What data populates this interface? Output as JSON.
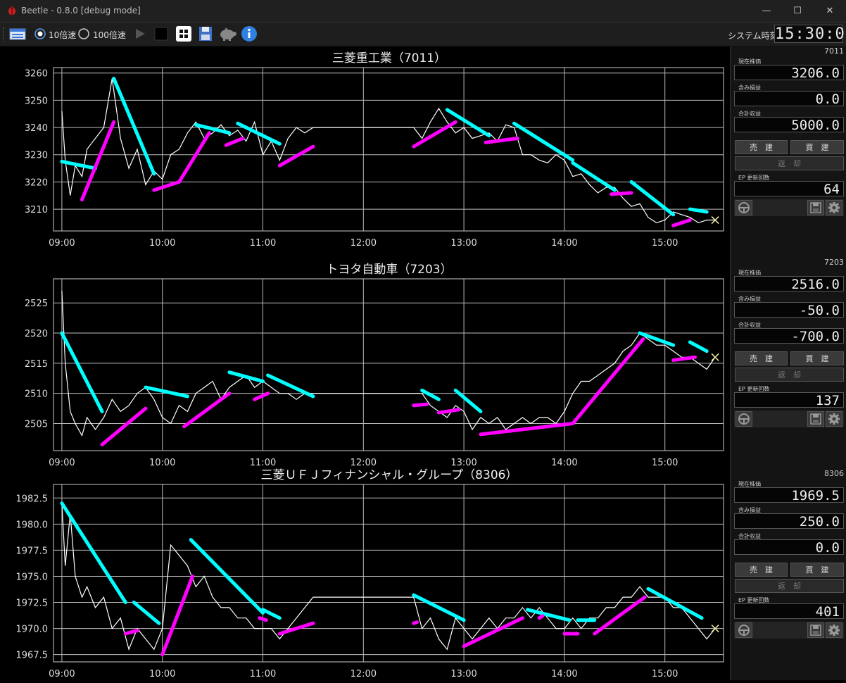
{
  "window": {
    "title": "Beetle - 0.8.0 [debug mode]",
    "minimize": "—",
    "maximize": "☐",
    "close": "✕"
  },
  "toolbar": {
    "speed_10_label": "10倍速",
    "speed_100_label": "100倍速",
    "selected_speed": "10倍速",
    "system_time_label": "システム時刻",
    "system_time": "15:30:01"
  },
  "colors": {
    "background": "#000000",
    "price_line": "#ffffff",
    "trend_up": "#ff00ff",
    "trend_down": "#00ffff",
    "grid": "#888888"
  },
  "charts": [
    {
      "title": "三菱重工業（7011）",
      "ylabels": [
        "3260",
        "3250",
        "3240",
        "3230",
        "3220",
        "3210"
      ]
    },
    {
      "title": "トヨタ自動車（7203）",
      "ylabels": [
        "2525",
        "2520",
        "2515",
        "2510",
        "2505"
      ]
    },
    {
      "title": "三菱ＵＦＪフィナンシャル・グループ（8306）",
      "ylabels": [
        "1982.5",
        "1980.0",
        "1977.5",
        "1975.0",
        "1972.5",
        "1970.0",
        "1967.5"
      ]
    }
  ],
  "chart_data": [
    {
      "type": "line",
      "title": "三菱重工業（7011）",
      "x_ticks": [
        "09:00",
        "10:00",
        "11:00",
        "12:00",
        "13:00",
        "14:00",
        "15:00"
      ],
      "ylim": [
        3202,
        3262
      ],
      "series": [
        {
          "x": [
            "09:00",
            "09:02",
            "09:05",
            "09:08",
            "09:12",
            "09:15",
            "09:20",
            "09:25",
            "09:30",
            "09:35",
            "09:40",
            "09:45",
            "09:50",
            "09:55",
            "10:00",
            "10:05",
            "10:10",
            "10:15",
            "10:20",
            "10:25",
            "10:30",
            "10:35",
            "10:40",
            "10:45",
            "10:50",
            "10:55",
            "11:00",
            "11:05",
            "11:10",
            "11:15",
            "11:20",
            "11:25",
            "11:30",
            "12:30",
            "12:35",
            "12:40",
            "12:45",
            "12:50",
            "12:55",
            "13:00",
            "13:05",
            "13:10",
            "13:15",
            "13:20",
            "13:25",
            "13:30",
            "13:35",
            "13:40",
            "13:45",
            "13:50",
            "13:55",
            "14:00",
            "14:05",
            "14:10",
            "14:15",
            "14:20",
            "14:25",
            "14:30",
            "14:35",
            "14:40",
            "14:45",
            "14:50",
            "14:55",
            "15:00",
            "15:05",
            "15:10",
            "15:15",
            "15:20",
            "15:25",
            "15:30"
          ],
          "values": [
            3246,
            3228,
            3215,
            3226,
            3222,
            3232,
            3236,
            3240,
            3258,
            3236,
            3225,
            3232,
            3219,
            3224,
            3221,
            3230,
            3232,
            3238,
            3242,
            3236,
            3238,
            3241,
            3237,
            3239,
            3235,
            3242,
            3230,
            3235,
            3228,
            3236,
            3240,
            3238,
            3240,
            3240,
            3236,
            3242,
            3247,
            3242,
            3238,
            3240,
            3236,
            3237,
            3238,
            3235,
            3241,
            3240,
            3230,
            3230,
            3228,
            3227,
            3230,
            3228,
            3222,
            3223,
            3219,
            3216,
            3218,
            3218,
            3214,
            3211,
            3212,
            3207,
            3205,
            3206,
            3209,
            3208,
            3207,
            3205,
            3206,
            3206
          ]
        }
      ]
    },
    {
      "type": "line",
      "title": "トヨタ自動車（7203）",
      "x_ticks": [
        "09:00",
        "10:00",
        "11:00",
        "12:00",
        "13:00",
        "14:00",
        "15:00"
      ],
      "ylim": [
        2500.5,
        2529
      ],
      "series": [
        {
          "x": [
            "09:00",
            "09:02",
            "09:05",
            "09:08",
            "09:12",
            "09:15",
            "09:20",
            "09:25",
            "09:30",
            "09:35",
            "09:40",
            "09:45",
            "09:50",
            "09:55",
            "10:00",
            "10:05",
            "10:10",
            "10:15",
            "10:20",
            "10:25",
            "10:30",
            "10:35",
            "10:40",
            "10:45",
            "10:50",
            "10:55",
            "11:00",
            "11:05",
            "11:10",
            "11:15",
            "11:20",
            "11:25",
            "11:30",
            "12:30",
            "12:35",
            "12:40",
            "12:45",
            "12:50",
            "12:55",
            "13:00",
            "13:05",
            "13:10",
            "13:15",
            "13:20",
            "13:25",
            "13:30",
            "13:35",
            "13:40",
            "13:45",
            "13:50",
            "13:55",
            "14:00",
            "14:05",
            "14:10",
            "14:15",
            "14:20",
            "14:25",
            "14:30",
            "14:35",
            "14:40",
            "14:45",
            "14:50",
            "14:55",
            "15:00",
            "15:05",
            "15:10",
            "15:15",
            "15:20",
            "15:25",
            "15:30"
          ],
          "values": [
            2527,
            2515,
            2507,
            2505,
            2503,
            2506,
            2504,
            2506,
            2509,
            2507,
            2508,
            2510,
            2511,
            2509,
            2506,
            2505,
            2508,
            2507,
            2510,
            2511,
            2512,
            2509,
            2511,
            2512,
            2513,
            2511,
            2512,
            2511,
            2510,
            2510,
            2509,
            2510,
            2510,
            2510,
            2510,
            2508,
            2507,
            2506,
            2508,
            2507,
            2504,
            2506,
            2505,
            2506,
            2504,
            2505,
            2506,
            2505,
            2506,
            2506,
            2505,
            2507,
            2510,
            2512,
            2512,
            2513,
            2514,
            2515,
            2517,
            2518,
            2520,
            2519,
            2518,
            2518,
            2517,
            2516,
            2516,
            2515,
            2514,
            2516
          ]
        }
      ]
    },
    {
      "type": "line",
      "title": "三菱ＵＦＪフィナンシャル・グループ（8306）",
      "x_ticks": [
        "09:00",
        "10:00",
        "11:00",
        "12:00",
        "13:00",
        "14:00",
        "15:00"
      ],
      "ylim": [
        1966.8,
        1983.8
      ],
      "series": [
        {
          "x": [
            "09:00",
            "09:02",
            "09:05",
            "09:08",
            "09:12",
            "09:15",
            "09:20",
            "09:25",
            "09:30",
            "09:35",
            "09:40",
            "09:45",
            "09:50",
            "09:55",
            "10:00",
            "10:05",
            "10:10",
            "10:15",
            "10:20",
            "10:25",
            "10:30",
            "10:35",
            "10:40",
            "10:45",
            "10:50",
            "10:55",
            "11:00",
            "11:05",
            "11:10",
            "11:15",
            "11:20",
            "11:25",
            "11:30",
            "12:30",
            "12:35",
            "12:40",
            "12:45",
            "12:50",
            "12:55",
            "13:00",
            "13:05",
            "13:10",
            "13:15",
            "13:20",
            "13:25",
            "13:30",
            "13:35",
            "13:40",
            "13:45",
            "13:50",
            "13:55",
            "14:00",
            "14:05",
            "14:10",
            "14:15",
            "14:20",
            "14:25",
            "14:30",
            "14:35",
            "14:40",
            "14:45",
            "14:50",
            "14:55",
            "15:00",
            "15:05",
            "15:10",
            "15:15",
            "15:20",
            "15:25",
            "15:30"
          ],
          "values": [
            1982,
            1976,
            1981,
            1975,
            1973,
            1974,
            1972,
            1973,
            1970,
            1971,
            1968,
            1970,
            1969,
            1968,
            1970,
            1978,
            1977,
            1976,
            1974,
            1975,
            1973,
            1972,
            1972,
            1971,
            1971,
            1970,
            1970,
            1970,
            1969,
            1970,
            1971,
            1972,
            1973,
            1973,
            1970,
            1971,
            1969,
            1968,
            1971,
            1970,
            1969,
            1970,
            1971,
            1970,
            1971,
            1971,
            1972,
            1971,
            1972,
            1971,
            1970,
            1970,
            1971,
            1970,
            1971,
            1971,
            1972,
            1972,
            1973,
            1973,
            1974,
            1973,
            1973,
            1973,
            1972,
            1972,
            1971,
            1970,
            1969,
            1970
          ]
        }
      ]
    }
  ],
  "side_panels": [
    {
      "code": "7011",
      "price_label": "現在株価",
      "price": "3206.0",
      "unreal_label": "含み損益",
      "unreal": "0.0",
      "total_label": "合計収益",
      "total": "5000.0",
      "sell": "売　建",
      "buy": "買　建",
      "repay": "返　却",
      "ep_label": "EP 更新回数",
      "ep": "64"
    },
    {
      "code": "7203",
      "price_label": "現在株価",
      "price": "2516.0",
      "unreal_label": "含み損益",
      "unreal": "-50.0",
      "total_label": "合計収益",
      "total": "-700.0",
      "sell": "売　建",
      "buy": "買　建",
      "repay": "返　却",
      "ep_label": "EP 更新回数",
      "ep": "137"
    },
    {
      "code": "8306",
      "price_label": "現在株価",
      "price": "1969.5",
      "unreal_label": "含み損益",
      "unreal": "250.0",
      "total_label": "合計収益",
      "total": "0.0",
      "sell": "売　建",
      "buy": "買　建",
      "repay": "返　却",
      "ep_label": "EP 更新回数",
      "ep": "401"
    }
  ]
}
